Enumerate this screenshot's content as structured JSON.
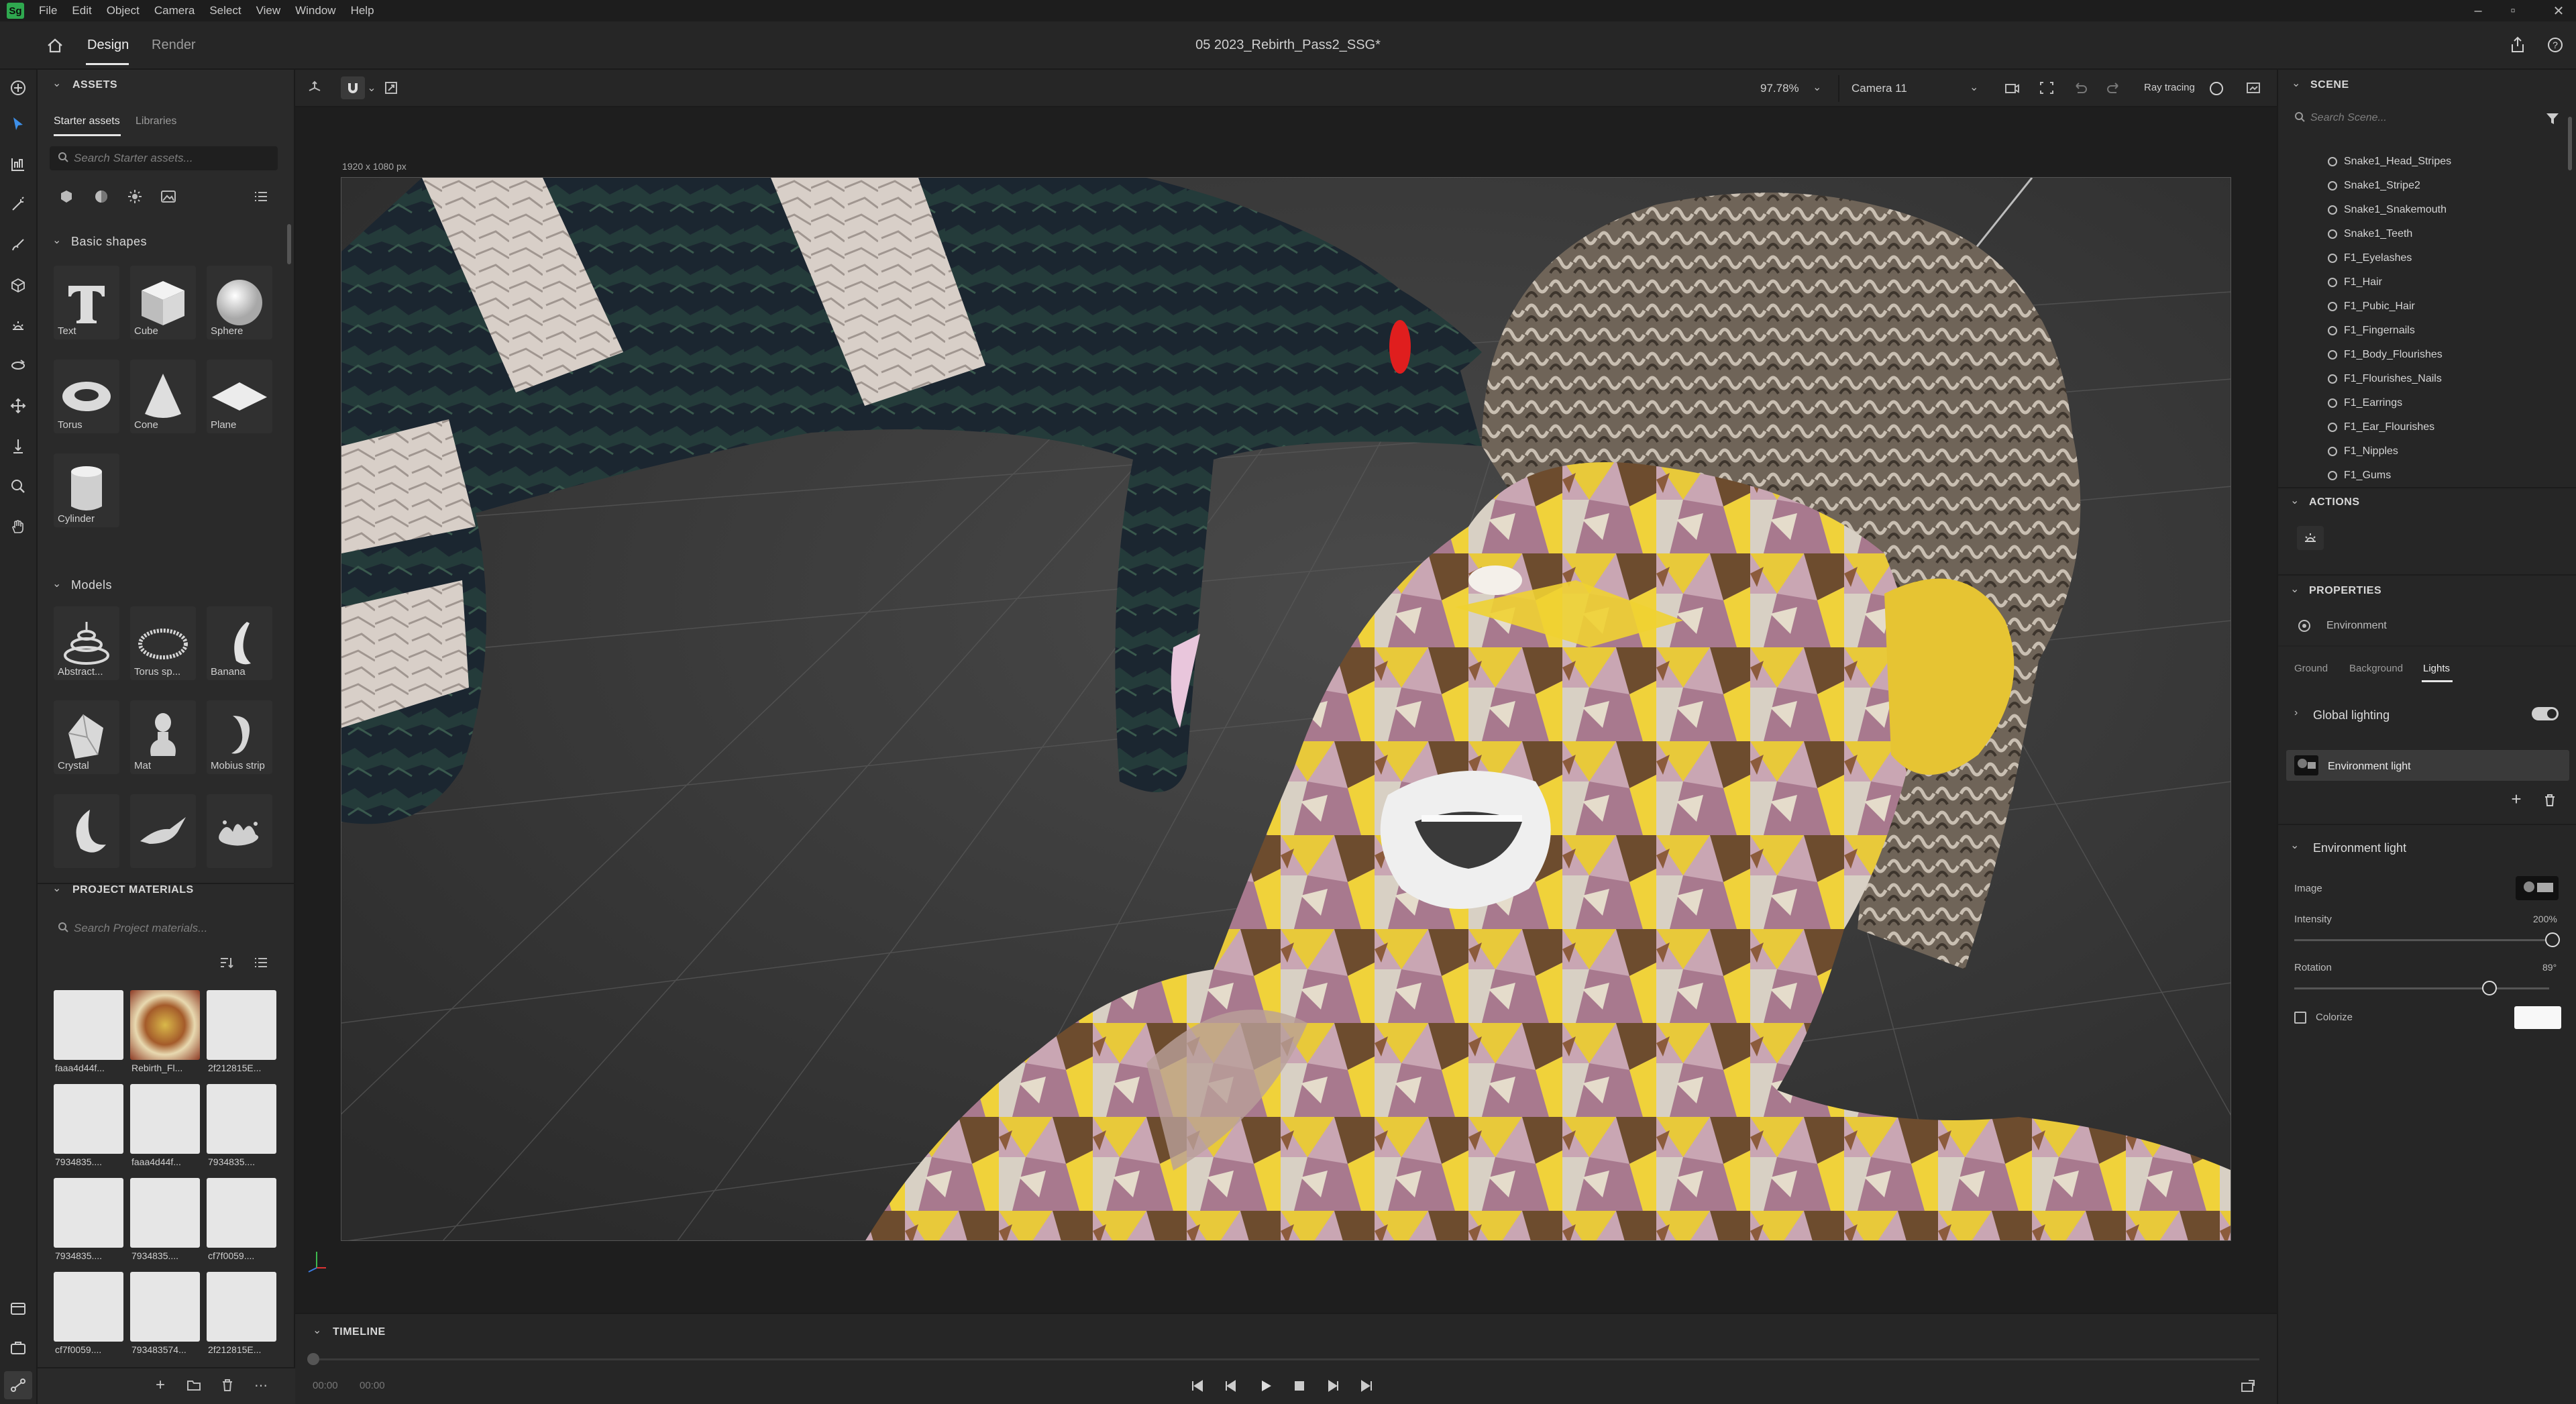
{
  "app": {
    "logo": "Sg"
  },
  "menu": [
    "File",
    "Edit",
    "Object",
    "Camera",
    "Select",
    "View",
    "Window",
    "Help"
  ],
  "tabs": {
    "design": "Design",
    "render": "Render"
  },
  "document_title": "05 2023_Rebirth_Pass2_SSG*",
  "viewport": {
    "zoom": "97.78%",
    "camera": "Camera 11",
    "ray_tracing": "Ray tracing",
    "size_label": "1920 x 1080 px"
  },
  "assets": {
    "header": "ASSETS",
    "tab_starter": "Starter assets",
    "tab_libraries": "Libraries",
    "search_placeholder": "Search Starter assets...",
    "basic_shapes_header": "Basic shapes",
    "basic_shapes": [
      "Text",
      "Cube",
      "Sphere",
      "Torus",
      "Cone",
      "Plane",
      "Cylinder"
    ],
    "models_header": "Models",
    "models": [
      "Abstract...",
      "Torus sp...",
      "Banana",
      "Crystal",
      "Mat",
      "Mobius strip",
      "",
      "",
      ""
    ],
    "project_materials_header": "PROJECT MATERIALS",
    "materials_search_placeholder": "Search Project materials...",
    "materials": [
      "faaa4d44f...",
      "Rebirth_Fl...",
      "2f212815E...",
      "7934835....",
      "faaa4d44f...",
      "7934835....",
      "7934835....",
      "7934835....",
      "cf7f0059....",
      "cf7f0059....",
      "793483574...",
      "2f212815E..."
    ]
  },
  "scene": {
    "header": "SCENE",
    "search_placeholder": "Search Scene...",
    "items": [
      "Snake1_Head_Stripes",
      "Snake1_Stripe2",
      "Snake1_Snakemouth",
      "Snake1_Teeth",
      "F1_Eyelashes",
      "F1_Hair",
      "F1_Pubic_Hair",
      "F1_Fingernails",
      "F1_Body_Flourishes",
      "F1_Flourishes_Nails",
      "F1_Earrings",
      "F1_Ear_Flourishes",
      "F1_Nipples",
      "F1_Gums"
    ]
  },
  "actions": {
    "header": "ACTIONS"
  },
  "properties": {
    "header": "PROPERTIES",
    "object": "Environment",
    "tabs": [
      "Ground",
      "Background",
      "Lights"
    ],
    "global_lighting": "Global lighting",
    "env_light_item": "Environment light",
    "env_section": "Environment light",
    "image_label": "Image",
    "intensity_label": "Intensity",
    "intensity_value": "200%",
    "rotation_label": "Rotation",
    "rotation_value": "89°",
    "colorize_label": "Colorize"
  },
  "timeline": {
    "header": "TIMELINE",
    "time_start": "00:00",
    "time_end": "00:00"
  },
  "colors": {
    "accent": "#2fa84f",
    "selection": "#3a3a3a"
  }
}
